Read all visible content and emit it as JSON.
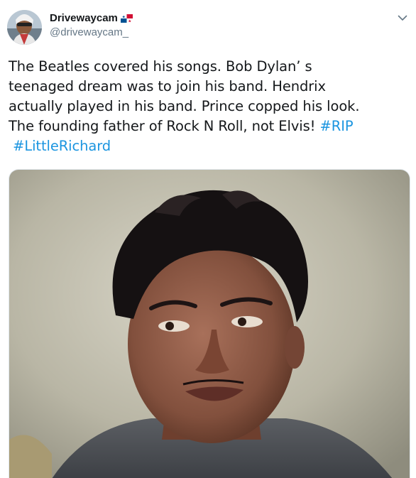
{
  "tweet": {
    "display_name": "Drivewaycam",
    "handle": "@drivewaycam_",
    "avatar_icon": "user-avatar-icon",
    "flag_icon": "panama-flag-icon",
    "menu_icon": "chevron-down-icon",
    "text_lines": [
      "The Beatles covered his songs. Bob Dylan’  s",
      "teenaged dream was to join his band. Hendrix",
      "actually played in his band. Prince copped his look.",
      "The founding father of Rock N Roll, not Elvis!"
    ],
    "hashtags": [
      "#RIP",
      "#LittleRichard"
    ],
    "media_alt": "portrait photograph",
    "colors": {
      "hashtag": "#1b95e0",
      "handle": "#657786",
      "text": "#14171a"
    }
  }
}
